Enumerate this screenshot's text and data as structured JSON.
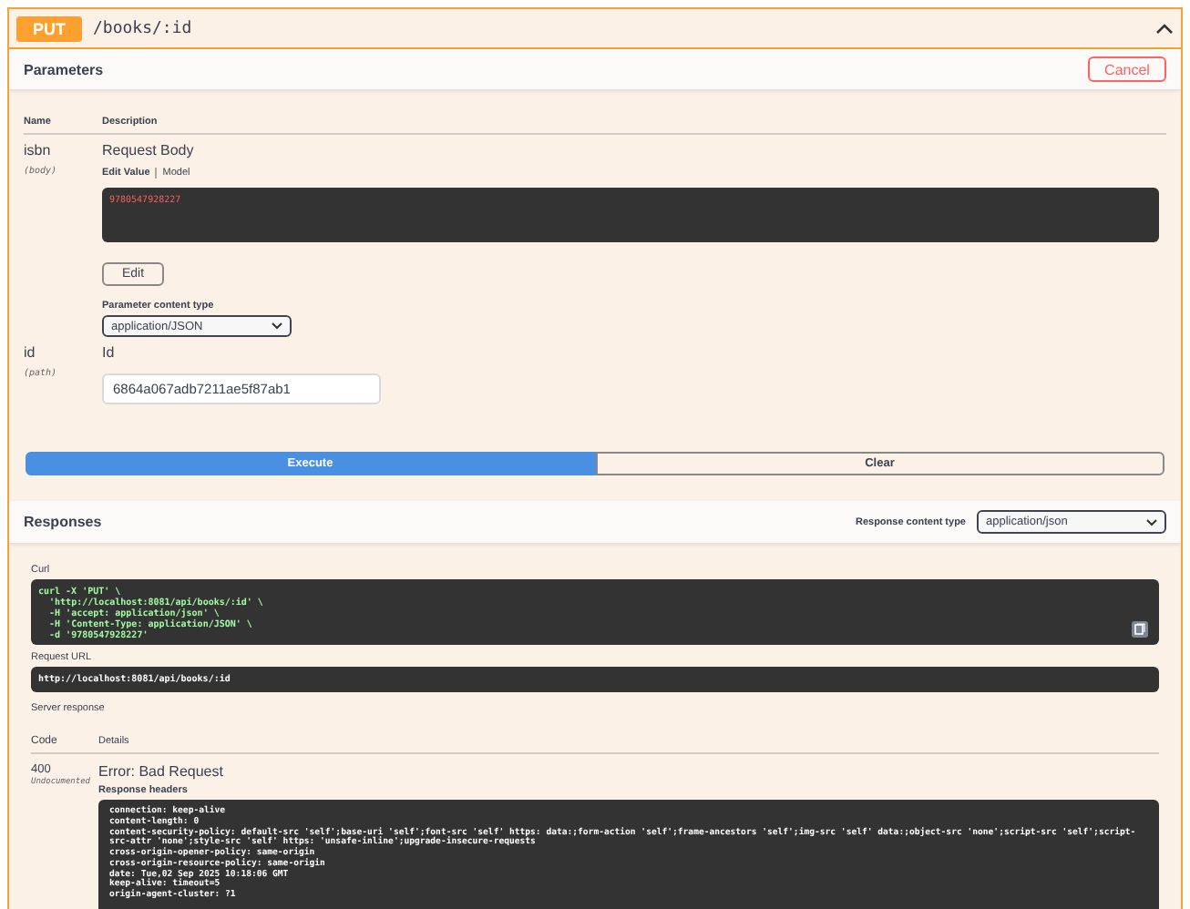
{
  "operation": {
    "method": "PUT",
    "path": "/books/:id",
    "expanded": true
  },
  "parameters": {
    "title": "Parameters",
    "cancel_button": "Cancel",
    "columns": [
      "Name",
      "Description"
    ],
    "rows": [
      {
        "kind": "body",
        "name": "isbn",
        "location": "(body)",
        "description": "Request Body",
        "tabs": [
          {
            "label": "Edit Value",
            "selected": true
          },
          {
            "label": "Model",
            "selected": false
          }
        ],
        "value": "9780547928227",
        "edit_button": "Edit",
        "content_type_label": "Parameter content type",
        "content_type": "application/JSON"
      },
      {
        "kind": "text",
        "name": "id",
        "location": "(path)",
        "description": "Id",
        "value": "6864a067adb7211ae5f87ab1"
      }
    ],
    "execute_button": "Execute",
    "clear_button": "Clear"
  },
  "responses": {
    "title": "Responses",
    "content_type_label": "Response content type",
    "content_type": "application/json",
    "curl_label": "Curl",
    "curl_lines": [
      "curl -X 'PUT' \\",
      "  'http://localhost:8081/api/books/:id' \\",
      "  -H 'accept: application/json' \\",
      "  -H 'Content-Type: application/JSON' \\",
      "  -d '9780547928227'"
    ],
    "request_url_label": "Request URL",
    "request_url": "http://localhost:8081/api/books/:id",
    "server_response_label": "Server response",
    "columns": [
      "Code",
      "Details"
    ],
    "rows": [
      {
        "code": "400",
        "note": "Undocumented",
        "title": "Error: Bad Request",
        "headers_label": "Response headers",
        "headers": [
          "connection: keep-alive",
          "content-length: 0",
          "content-security-policy: default-src 'self';base-uri 'self';font-src 'self' https: data:;form-action 'self';frame-ancestors 'self';img-src 'self' data:;object-src 'none';script-src 'self';script-src-attr 'none';style-src 'self' https: 'unsafe-inline';upgrade-insecure-requests",
          "cross-origin-opener-policy: same-origin",
          "cross-origin-resource-policy: same-origin",
          "date: Tue,02 Sep 2025 10:18:06 GMT",
          "keep-alive: timeout=5",
          "origin-agent-cluster: ?1"
        ]
      }
    ]
  }
}
